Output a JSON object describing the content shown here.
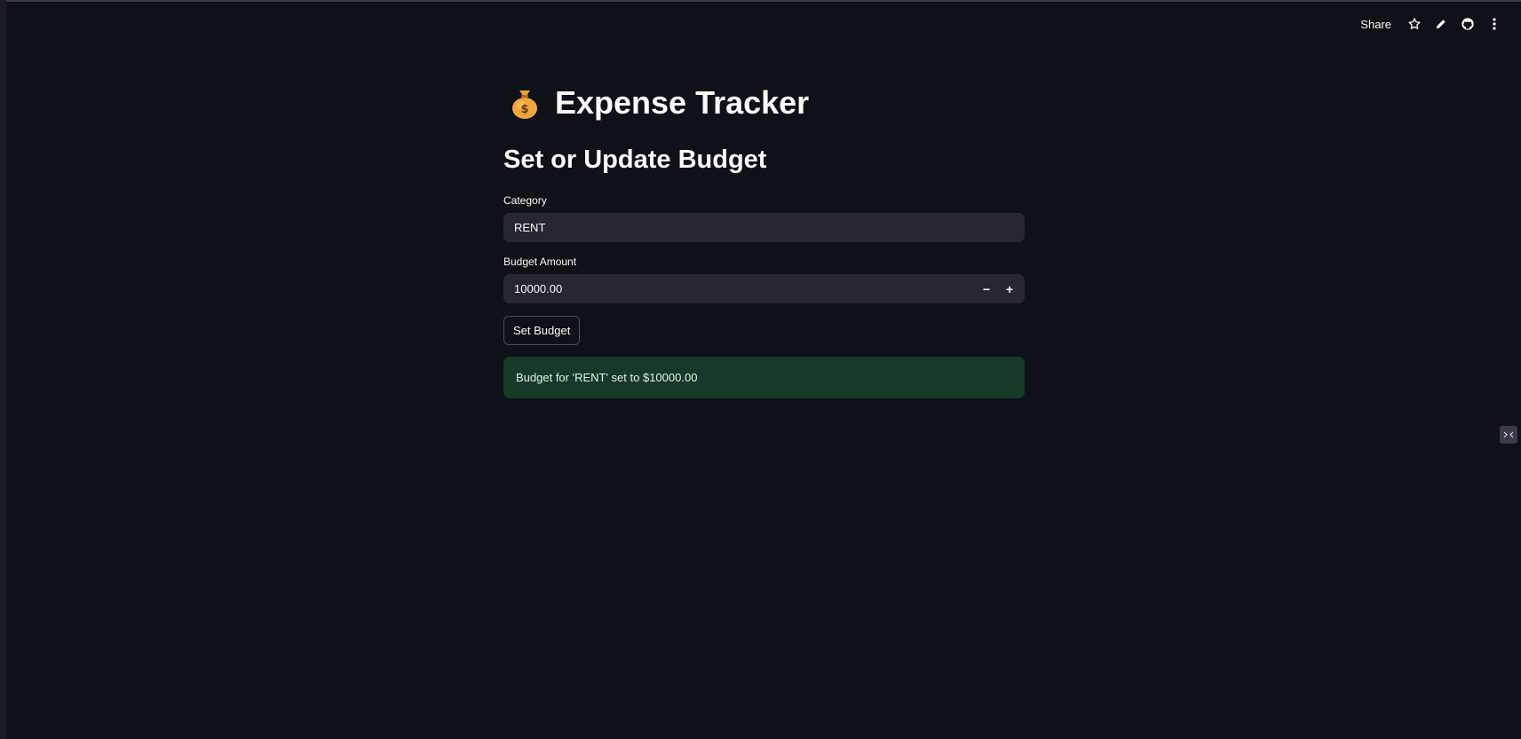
{
  "toolbar": {
    "share_label": "Share",
    "icons": [
      "star-icon",
      "pencil-icon",
      "github-icon",
      "kebab-menu-icon"
    ]
  },
  "header": {
    "emoji": "money-bag-icon",
    "title": "Expense Tracker"
  },
  "form": {
    "subheading": "Set or Update Budget",
    "category_label": "Category",
    "category_value": "RENT",
    "amount_label": "Budget Amount",
    "amount_value": "10000.00",
    "minus_label": "−",
    "plus_label": "+",
    "submit_label": "Set Budget"
  },
  "alert": {
    "message": "Budget for 'RENT' set to $10000.00"
  },
  "colors": {
    "background": "#0e1117",
    "input_bg": "#262730",
    "success_bg": "#173928",
    "text": "#fafafa"
  }
}
